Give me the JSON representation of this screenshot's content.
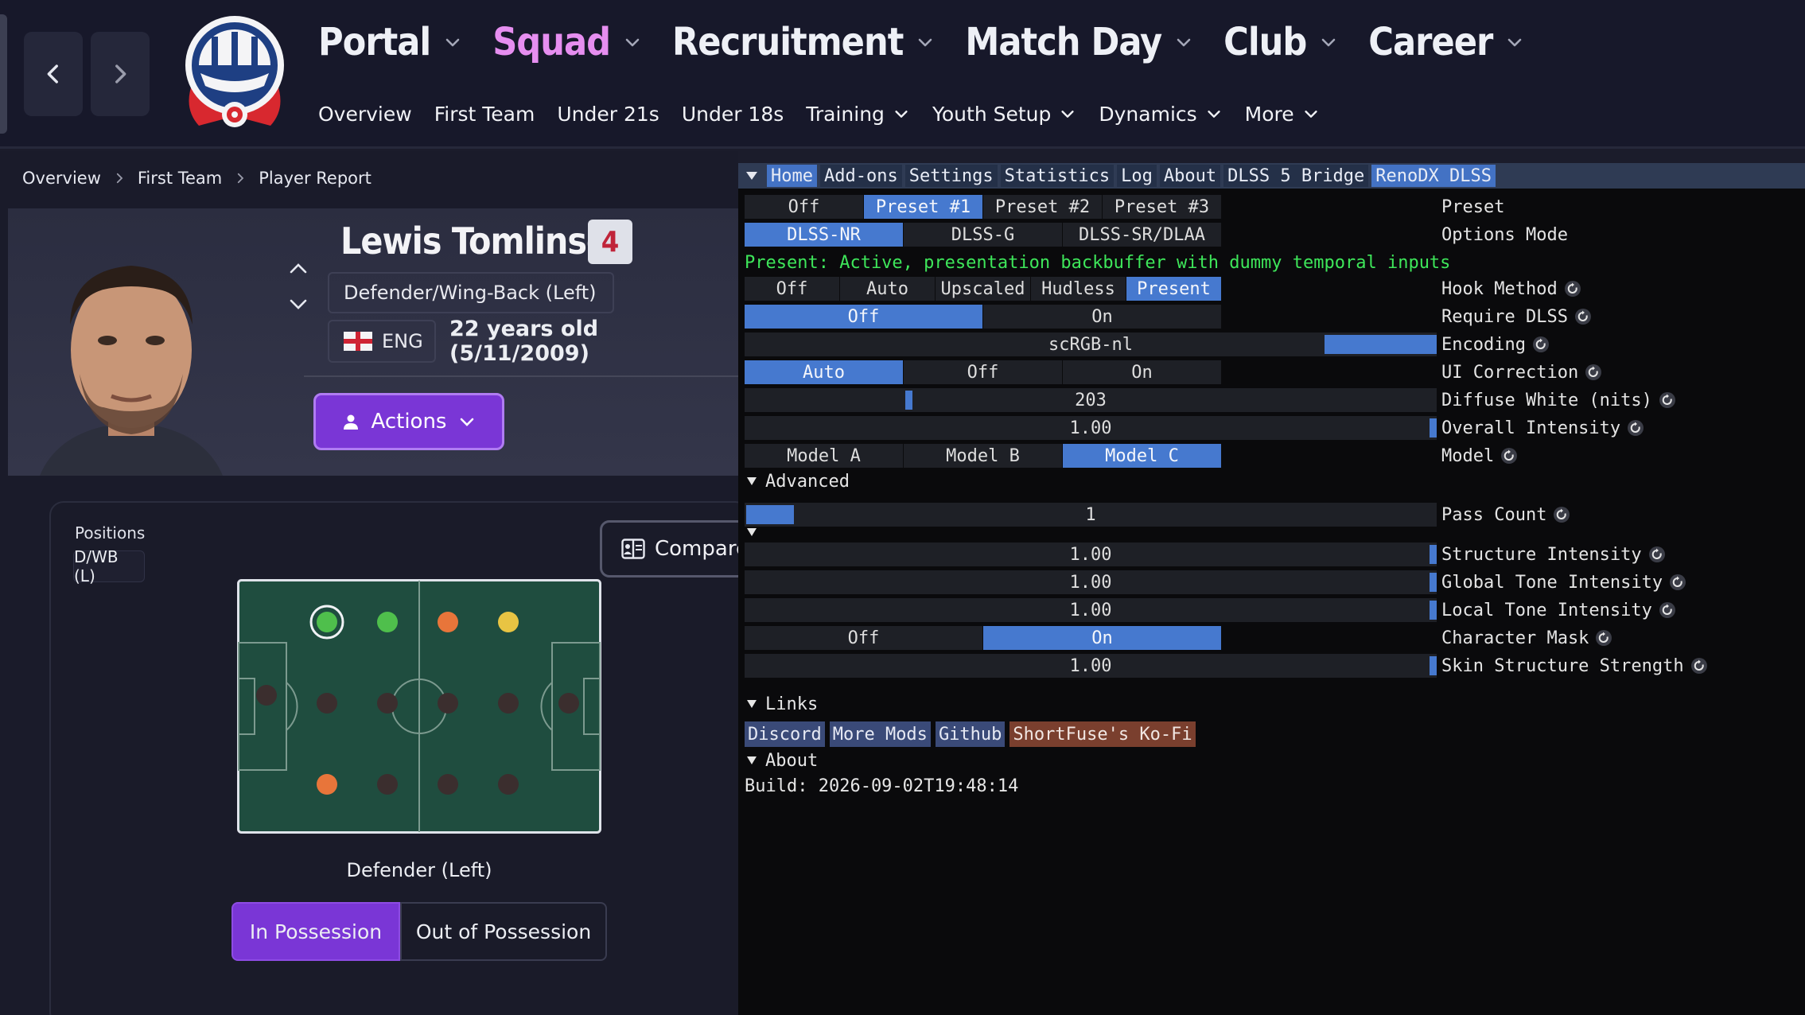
{
  "header": {
    "main_nav": [
      "Portal",
      "Squad",
      "Recruitment",
      "Match Day",
      "Club",
      "Career"
    ],
    "active_main": "Squad",
    "sub_nav": [
      {
        "label": "Overview",
        "has_chevron": false
      },
      {
        "label": "First Team",
        "has_chevron": false
      },
      {
        "label": "Under 21s",
        "has_chevron": false
      },
      {
        "label": "Under 18s",
        "has_chevron": false
      },
      {
        "label": "Training",
        "has_chevron": true
      },
      {
        "label": "Youth Setup",
        "has_chevron": true
      },
      {
        "label": "Dynamics",
        "has_chevron": true
      },
      {
        "label": "More",
        "has_chevron": true
      }
    ],
    "icons": {
      "back": "chevron-left-icon",
      "forward": "chevron-right-icon",
      "logo": "club-crest-icon"
    }
  },
  "breadcrumb": [
    "Overview",
    "First Team",
    "Player Report"
  ],
  "player": {
    "name": "Lewis Tomlinson",
    "number": "4",
    "role": "Defender/Wing-Back (Left)",
    "nationality": "ENG",
    "age_text": "22 years old (5/11/2009)",
    "actions_label": "Actions"
  },
  "positions": {
    "heading": "Positions",
    "badge": "D/WB (L)",
    "compare_label": "Compare",
    "pitch_caption": "Defender (Left)",
    "tabs": [
      "In Possession",
      "Out of Possession"
    ],
    "active_tab": "In Possession",
    "colors": {
      "pitch": "#1f4d3f",
      "green": "#4fbf4c",
      "orange": "#e8753a",
      "yellow": "#e8c443",
      "empty": "#3b2e2e"
    }
  },
  "overlay": {
    "menu": [
      "Home",
      "Add-ons",
      "Settings",
      "Statistics",
      "Log",
      "About",
      "DLSS 5 Bridge",
      "RenoDX DLSS"
    ],
    "active_menu": [
      "Home",
      "RenoDX DLSS"
    ],
    "preset": {
      "label": "Preset",
      "options": [
        "Off",
        "Preset #1",
        "Preset #2",
        "Preset #3"
      ],
      "selected": "Preset #1"
    },
    "options_mode": {
      "label": "Options Mode",
      "options": [
        "DLSS-NR",
        "DLSS-G",
        "DLSS-SR/DLAA"
      ],
      "selected": "DLSS-NR"
    },
    "status": "Present: Active, presentation backbuffer with dummy temporal inputs",
    "hook_method": {
      "label": "Hook Method",
      "options": [
        "Off",
        "Auto",
        "Upscaled",
        "Hudless",
        "Present"
      ],
      "selected": "Present"
    },
    "require_dlss": {
      "label": "Require DLSS",
      "options": [
        "Off",
        "On"
      ],
      "selected": "Off"
    },
    "encoding": {
      "label": "Encoding",
      "value": "scRGB-nl"
    },
    "ui_correction": {
      "label": "UI Correction",
      "options": [
        "Auto",
        "Off",
        "On"
      ],
      "selected": "Auto"
    },
    "diffuse_white": {
      "label": "Diffuse White (nits)",
      "value": "203",
      "fraction": 0.237
    },
    "overall_intensity": {
      "label": "Overall Intensity",
      "value": "1.00",
      "fraction": 1.0
    },
    "model": {
      "label": "Model",
      "options": [
        "Model A",
        "Model B",
        "Model C"
      ],
      "selected": "Model C"
    },
    "advanced_label": "Advanced",
    "pass_count": {
      "label": "Pass Count",
      "value": "1",
      "fraction": 0.07
    },
    "structure_intensity": {
      "label": "Structure Intensity",
      "value": "1.00",
      "fraction": 1.0
    },
    "global_tone": {
      "label": "Global Tone Intensity",
      "value": "1.00",
      "fraction": 1.0
    },
    "local_tone": {
      "label": "Local Tone Intensity",
      "value": "1.00",
      "fraction": 1.0
    },
    "character_mask": {
      "label": "Character Mask",
      "options": [
        "Off",
        "On"
      ],
      "selected": "On"
    },
    "skin_structure": {
      "label": "Skin Structure Strength",
      "value": "1.00",
      "fraction": 1.0
    },
    "links_label": "Links",
    "links": [
      "Discord",
      "More Mods",
      "Github",
      "ShortFuse's Ko-Fi"
    ],
    "about_label": "About",
    "build": "Build: 2026-09-02T19:48:14",
    "accent": "#4679cf",
    "status_color": "#3ee65a"
  }
}
